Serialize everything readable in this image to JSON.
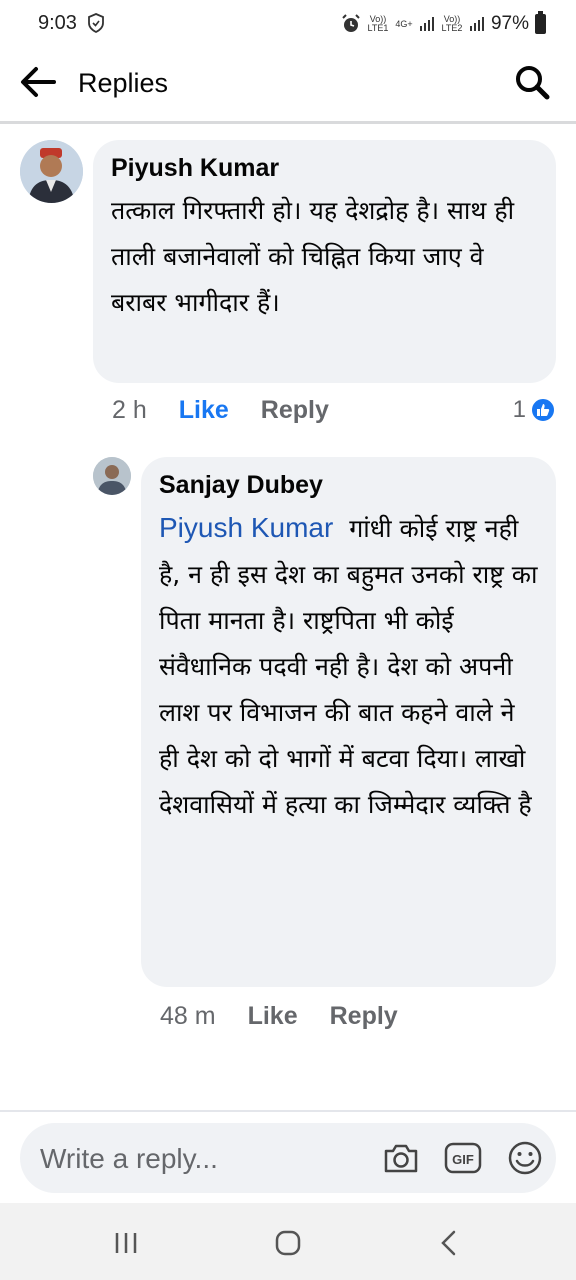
{
  "status_bar": {
    "time": "9:03",
    "sim1_label": "Vo)) LTE1",
    "sim2_label": "Vo)) LTE2",
    "network": "4G+",
    "battery": "97%"
  },
  "header": {
    "title": "Replies"
  },
  "comment": {
    "author": "Piyush Kumar",
    "text": "तत्काल गिरफ्तारी हो। यह देशद्रोह है। साथ ही ताली बजानेवालों को चिह्नित किया जाए वे बराबर भागीदार हैं।",
    "time": "2 h",
    "like_label": "Like",
    "reply_label": "Reply",
    "reaction_count": "1"
  },
  "reply": {
    "author": "Sanjay Dubey",
    "mention": "Piyush Kumar",
    "text": "गांधी कोई राष्ट्र नही है, न ही इस देश का बहुमत उनको राष्ट्र का पिता मानता है।  राष्ट्रपिता भी कोई संवैधानिक पदवी नही है। देश को अपनी लाश पर  विभाजन की बात कहने वाले ने ही देश को दो भागों में  बटवा दिया। लाखो देशवासियों में हत्या का जिम्मेदार व्यक्ति है",
    "time": "48 m",
    "like_label": "Like",
    "reply_label": "Reply"
  },
  "composer": {
    "placeholder": "Write a reply...",
    "icons": [
      "camera-icon",
      "gif-icon",
      "emoji-icon"
    ]
  },
  "colors": {
    "accent": "#1877f2",
    "mention": "#1e57b4",
    "bubble": "#f0f2f5",
    "muted": "#65676b"
  }
}
